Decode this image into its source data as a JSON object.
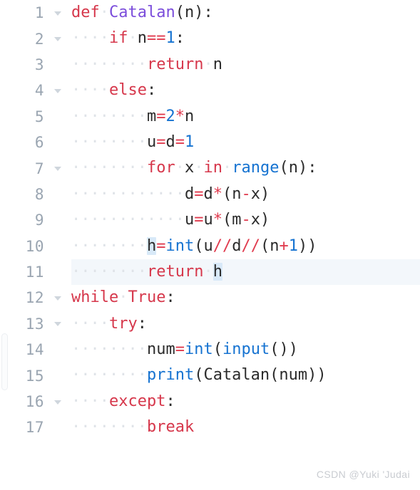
{
  "editor": {
    "language": "python",
    "background_color": "#ffffff",
    "current_line": 11,
    "colors": {
      "keyword": "#d6374b",
      "function_def": "#7b4ddb",
      "builtin": "#1673d1",
      "number": "#1673d1",
      "operator": "#e03b4e",
      "plain": "#2b2b2b",
      "line_number": "#9aa5b1",
      "indent_guide": "#dfe3e8",
      "occurrence_highlight": "#d8e9f8",
      "current_line_highlight": "#f3f7fb"
    },
    "lines": [
      {
        "number": "1",
        "foldable": true,
        "indent": 0,
        "text": "def Catalan(n):",
        "tokens": [
          {
            "t": "def",
            "c": "kw"
          },
          {
            "t": " ",
            "c": "sp"
          },
          {
            "t": "Catalan",
            "c": "fn"
          },
          {
            "t": "(n):",
            "c": "pl"
          }
        ]
      },
      {
        "number": "2",
        "foldable": true,
        "indent": 4,
        "text": "if n==1:",
        "tokens": [
          {
            "t": "if",
            "c": "kw"
          },
          {
            "t": " ",
            "c": "sp"
          },
          {
            "t": "n",
            "c": "pl"
          },
          {
            "t": "==",
            "c": "op"
          },
          {
            "t": "1",
            "c": "num"
          },
          {
            "t": ":",
            "c": "pl"
          }
        ]
      },
      {
        "number": "3",
        "foldable": false,
        "indent": 8,
        "text": "return n",
        "tokens": [
          {
            "t": "return",
            "c": "kw"
          },
          {
            "t": " ",
            "c": "sp"
          },
          {
            "t": "n",
            "c": "pl"
          }
        ]
      },
      {
        "number": "4",
        "foldable": true,
        "indent": 4,
        "text": "else:",
        "tokens": [
          {
            "t": "else",
            "c": "kw"
          },
          {
            "t": ":",
            "c": "pl"
          }
        ]
      },
      {
        "number": "5",
        "foldable": false,
        "indent": 8,
        "text": "m=2*n",
        "tokens": [
          {
            "t": "m",
            "c": "pl"
          },
          {
            "t": "=",
            "c": "op"
          },
          {
            "t": "2",
            "c": "num"
          },
          {
            "t": "*",
            "c": "op"
          },
          {
            "t": "n",
            "c": "pl"
          }
        ]
      },
      {
        "number": "6",
        "foldable": false,
        "indent": 8,
        "text": "u=d=1",
        "tokens": [
          {
            "t": "u",
            "c": "pl"
          },
          {
            "t": "=",
            "c": "op"
          },
          {
            "t": "d",
            "c": "pl"
          },
          {
            "t": "=",
            "c": "op"
          },
          {
            "t": "1",
            "c": "num"
          }
        ]
      },
      {
        "number": "7",
        "foldable": true,
        "indent": 8,
        "text": "for x in range(n):",
        "tokens": [
          {
            "t": "for",
            "c": "kw"
          },
          {
            "t": " ",
            "c": "sp"
          },
          {
            "t": "x",
            "c": "pl"
          },
          {
            "t": " ",
            "c": "sp"
          },
          {
            "t": "in",
            "c": "kw"
          },
          {
            "t": " ",
            "c": "sp"
          },
          {
            "t": "range",
            "c": "bi"
          },
          {
            "t": "(n):",
            "c": "pl"
          }
        ]
      },
      {
        "number": "8",
        "foldable": false,
        "indent": 12,
        "text": "d=d*(n-x)",
        "tokens": [
          {
            "t": "d",
            "c": "pl"
          },
          {
            "t": "=",
            "c": "op"
          },
          {
            "t": "d",
            "c": "pl"
          },
          {
            "t": "*",
            "c": "op"
          },
          {
            "t": "(n",
            "c": "pl"
          },
          {
            "t": "-",
            "c": "op"
          },
          {
            "t": "x)",
            "c": "pl"
          }
        ]
      },
      {
        "number": "9",
        "foldable": false,
        "indent": 12,
        "text": "u=u*(m-x)",
        "tokens": [
          {
            "t": "u",
            "c": "pl"
          },
          {
            "t": "=",
            "c": "op"
          },
          {
            "t": "u",
            "c": "pl"
          },
          {
            "t": "*",
            "c": "op"
          },
          {
            "t": "(m",
            "c": "pl"
          },
          {
            "t": "-",
            "c": "op"
          },
          {
            "t": "x)",
            "c": "pl"
          }
        ]
      },
      {
        "number": "10",
        "foldable": false,
        "indent": 8,
        "text": "h=int(u//d//(n+1))",
        "tokens": [
          {
            "t": "h",
            "c": "pl",
            "hl": true
          },
          {
            "t": "=",
            "c": "op"
          },
          {
            "t": "int",
            "c": "bi"
          },
          {
            "t": "(u",
            "c": "pl"
          },
          {
            "t": "//",
            "c": "op"
          },
          {
            "t": "d",
            "c": "pl"
          },
          {
            "t": "//",
            "c": "op"
          },
          {
            "t": "(n",
            "c": "pl"
          },
          {
            "t": "+",
            "c": "op"
          },
          {
            "t": "1",
            "c": "num"
          },
          {
            "t": "))",
            "c": "pl"
          }
        ]
      },
      {
        "number": "11",
        "foldable": false,
        "indent": 8,
        "text": "return h",
        "current": true,
        "tokens": [
          {
            "t": "return",
            "c": "kw"
          },
          {
            "t": " ",
            "c": "sp"
          },
          {
            "t": "h",
            "c": "pl",
            "hl": true
          }
        ]
      },
      {
        "number": "12",
        "foldable": true,
        "indent": 0,
        "text": "while True:",
        "tokens": [
          {
            "t": "while",
            "c": "kw"
          },
          {
            "t": " ",
            "c": "sp"
          },
          {
            "t": "True",
            "c": "kw"
          },
          {
            "t": ":",
            "c": "pl"
          }
        ]
      },
      {
        "number": "13",
        "foldable": true,
        "indent": 4,
        "text": "try:",
        "tokens": [
          {
            "t": "try",
            "c": "kw"
          },
          {
            "t": ":",
            "c": "pl"
          }
        ]
      },
      {
        "number": "14",
        "foldable": false,
        "indent": 8,
        "text": "num=int(input())",
        "tokens": [
          {
            "t": "num",
            "c": "pl"
          },
          {
            "t": "=",
            "c": "op"
          },
          {
            "t": "int",
            "c": "bi"
          },
          {
            "t": "(",
            "c": "pl"
          },
          {
            "t": "input",
            "c": "bi"
          },
          {
            "t": "())",
            "c": "pl"
          }
        ]
      },
      {
        "number": "15",
        "foldable": false,
        "indent": 8,
        "text": "print(Catalan(num))",
        "tokens": [
          {
            "t": "print",
            "c": "bi"
          },
          {
            "t": "(Catalan(num))",
            "c": "pl"
          }
        ]
      },
      {
        "number": "16",
        "foldable": true,
        "indent": 4,
        "text": "except:",
        "tokens": [
          {
            "t": "except",
            "c": "kw"
          },
          {
            "t": ":",
            "c": "pl"
          }
        ]
      },
      {
        "number": "17",
        "foldable": false,
        "indent": 8,
        "text": "break",
        "tokens": [
          {
            "t": "break",
            "c": "kw"
          }
        ]
      }
    ]
  },
  "watermark": {
    "text": "CSDN @Yuki 'Judai"
  }
}
